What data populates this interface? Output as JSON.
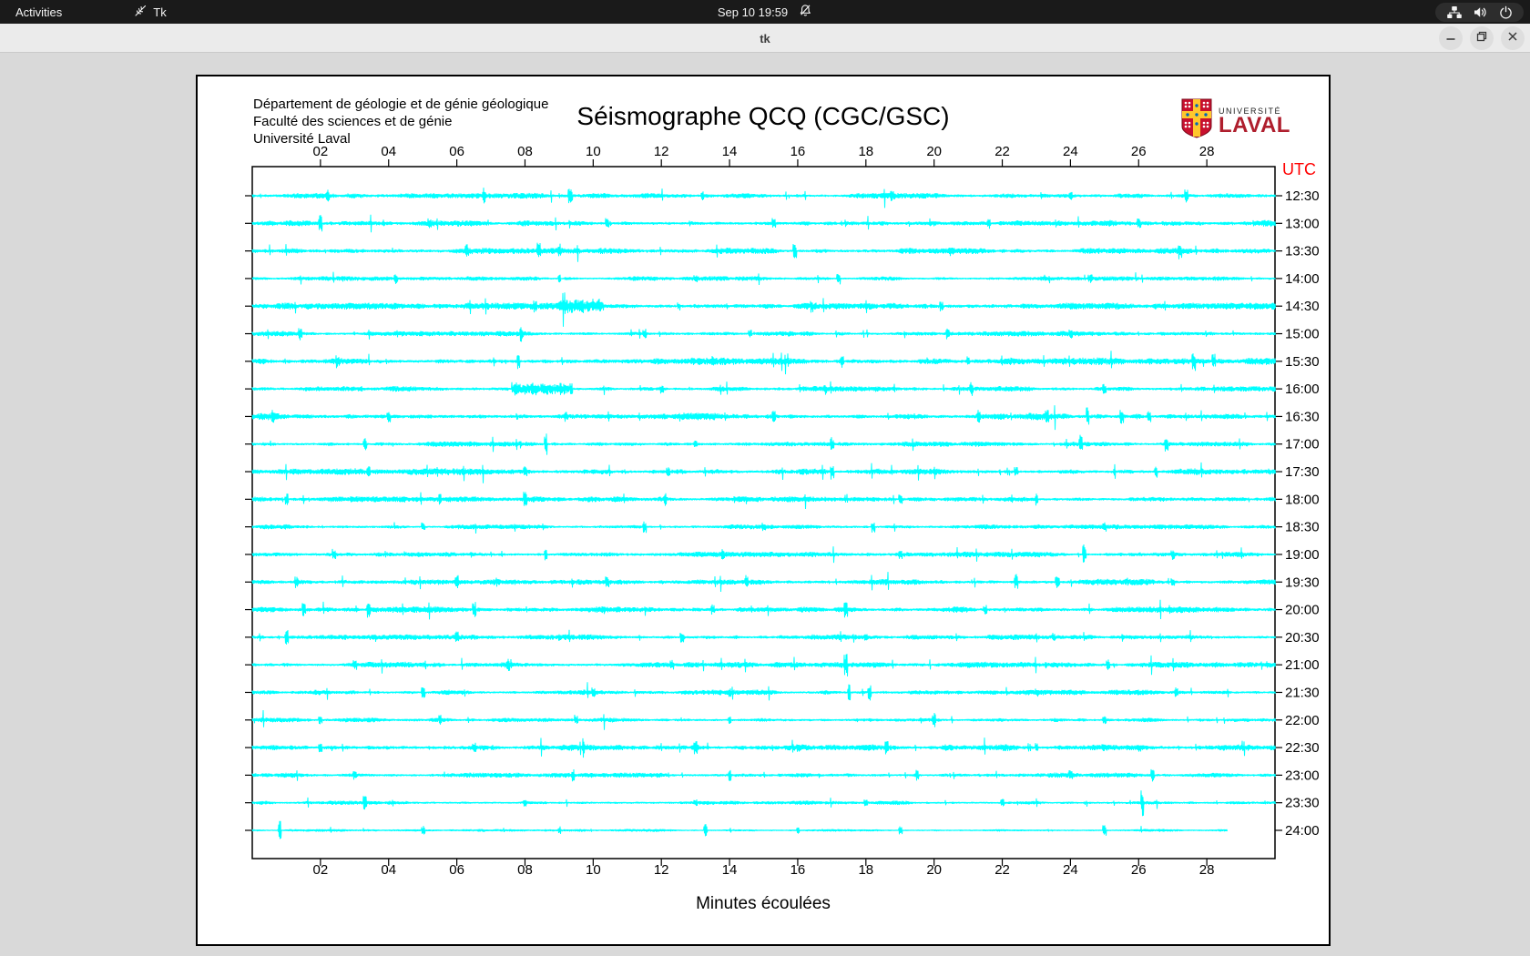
{
  "top_bar": {
    "activities": "Activities",
    "app_name": "Tk",
    "clock": "Sep 10 19:59",
    "icons": [
      "tk-feather-icon",
      "notifications-disabled-icon",
      "network-wired-icon",
      "volume-icon",
      "power-icon"
    ]
  },
  "title_bar": {
    "title": "tk",
    "icons": [
      "minimize-icon",
      "restore-icon",
      "close-icon"
    ]
  },
  "canvas": {
    "header_lines": [
      "Département de géologie et de génie géologique",
      "Faculté des sciences et de génie",
      "Université Laval"
    ],
    "title": "Séismographe QCQ (CGC/GSC)",
    "logo": {
      "line1": "UNIVERSITÉ",
      "line2": "LAVAL"
    },
    "x_axis_label": "Minutes écoulées",
    "utc_label": "UTC",
    "colors": {
      "trace": "#00ffff",
      "utc": "#ff0000",
      "axis": "#000000",
      "laval_red": "#af1e2d"
    },
    "plot": {
      "type": "heliplot-seismogram",
      "x_range_minutes": [
        0,
        30
      ],
      "x_ticks": [
        "02",
        "04",
        "06",
        "08",
        "10",
        "12",
        "14",
        "16",
        "18",
        "20",
        "22",
        "24",
        "26",
        "28"
      ],
      "rows": [
        {
          "label": "12:30",
          "end": 30,
          "base": 2.0,
          "seed": 101,
          "spikes": [
            [
              2.2,
              9
            ],
            [
              6.8,
              8
            ],
            [
              9.3,
              10
            ],
            [
              13.2,
              8
            ],
            [
              18.8,
              7
            ],
            [
              24.0,
              7
            ],
            [
              27.4,
              9
            ]
          ],
          "bursts": []
        },
        {
          "label": "13:00",
          "end": 30,
          "base": 2.4,
          "seed": 202,
          "spikes": [
            [
              2.0,
              12
            ],
            [
              5.2,
              7
            ],
            [
              10.4,
              8
            ],
            [
              15.3,
              7
            ],
            [
              21.6,
              7
            ],
            [
              26.0,
              6
            ]
          ],
          "bursts": []
        },
        {
          "label": "13:30",
          "end": 30,
          "base": 2.2,
          "seed": 303,
          "spikes": [
            [
              6.3,
              9
            ],
            [
              8.4,
              12
            ],
            [
              9.0,
              9
            ],
            [
              15.9,
              9
            ],
            [
              20.5,
              7
            ],
            [
              27.2,
              10
            ]
          ],
          "bursts": []
        },
        {
          "label": "14:00",
          "end": 30,
          "base": 1.6,
          "seed": 404,
          "spikes": [
            [
              4.2,
              7
            ],
            [
              9.0,
              6
            ],
            [
              13.0,
              5
            ],
            [
              17.2,
              8
            ],
            [
              24.6,
              5
            ]
          ],
          "bursts": []
        },
        {
          "label": "14:30",
          "end": 30,
          "base": 2.4,
          "seed": 505,
          "spikes": [
            [
              8.3,
              8
            ],
            [
              12.5,
              6
            ],
            [
              16.4,
              8
            ],
            [
              20.2,
              7
            ]
          ],
          "bursts": [
            [
              9.0,
              10.3,
              9
            ]
          ]
        },
        {
          "label": "15:00",
          "end": 30,
          "base": 1.9,
          "seed": 606,
          "spikes": [
            [
              1.4,
              8
            ],
            [
              7.9,
              9
            ],
            [
              11.5,
              7
            ],
            [
              14.6,
              6
            ],
            [
              20.4,
              8
            ],
            [
              24.0,
              6
            ]
          ],
          "bursts": []
        },
        {
          "label": "15:30",
          "end": 30,
          "base": 2.6,
          "seed": 707,
          "spikes": [
            [
              2.5,
              8
            ],
            [
              7.8,
              12
            ],
            [
              13.5,
              7
            ],
            [
              17.3,
              8
            ],
            [
              21.0,
              7
            ],
            [
              27.6,
              12
            ],
            [
              28.2,
              9
            ]
          ],
          "bursts": []
        },
        {
          "label": "16:00",
          "end": 30,
          "base": 2.0,
          "seed": 808,
          "spikes": [
            [
              12.0,
              6
            ],
            [
              16.8,
              7
            ],
            [
              21.1,
              9
            ],
            [
              25.0,
              6
            ]
          ],
          "bursts": [
            [
              7.6,
              9.4,
              8
            ]
          ]
        },
        {
          "label": "16:30",
          "end": 30,
          "base": 2.6,
          "seed": 909,
          "spikes": [
            [
              0.6,
              9
            ],
            [
              4.0,
              8
            ],
            [
              9.2,
              7
            ],
            [
              15.3,
              9
            ],
            [
              21.3,
              8
            ],
            [
              23.3,
              10
            ],
            [
              24.5,
              12
            ],
            [
              25.5,
              10
            ],
            [
              26.3,
              9
            ]
          ],
          "bursts": []
        },
        {
          "label": "17:00",
          "end": 30,
          "base": 1.9,
          "seed": 1010,
          "spikes": [
            [
              3.3,
              7
            ],
            [
              8.6,
              13
            ],
            [
              13.0,
              6
            ],
            [
              17.0,
              8
            ],
            [
              24.3,
              12
            ],
            [
              26.8,
              9
            ]
          ],
          "bursts": []
        },
        {
          "label": "17:30",
          "end": 30,
          "base": 2.4,
          "seed": 1111,
          "spikes": [
            [
              3.4,
              9
            ],
            [
              8.0,
              7
            ],
            [
              12.2,
              6
            ],
            [
              17.0,
              9
            ],
            [
              22.4,
              7
            ],
            [
              26.5,
              7
            ]
          ],
          "bursts": []
        },
        {
          "label": "18:00",
          "end": 30,
          "base": 2.1,
          "seed": 1212,
          "spikes": [
            [
              1.0,
              7
            ],
            [
              5.5,
              8
            ],
            [
              8.0,
              10
            ],
            [
              12.1,
              8
            ],
            [
              19.0,
              6
            ],
            [
              23.0,
              7
            ]
          ],
          "bursts": []
        },
        {
          "label": "18:30",
          "end": 30,
          "base": 1.7,
          "seed": 1313,
          "spikes": [
            [
              5.0,
              5
            ],
            [
              11.5,
              8
            ],
            [
              15.0,
              6
            ],
            [
              18.2,
              7
            ],
            [
              25.0,
              6
            ]
          ],
          "bursts": []
        },
        {
          "label": "19:00",
          "end": 30,
          "base": 2.0,
          "seed": 1414,
          "spikes": [
            [
              2.4,
              7
            ],
            [
              8.6,
              8
            ],
            [
              13.8,
              6
            ],
            [
              19.0,
              7
            ],
            [
              24.4,
              13
            ],
            [
              27.0,
              7
            ]
          ],
          "bursts": []
        },
        {
          "label": "19:30",
          "end": 30,
          "base": 2.2,
          "seed": 1515,
          "spikes": [
            [
              1.3,
              7
            ],
            [
              6.0,
              9
            ],
            [
              10.4,
              7
            ],
            [
              14.5,
              9
            ],
            [
              22.4,
              10
            ],
            [
              23.6,
              9
            ],
            [
              27.0,
              6
            ]
          ],
          "bursts": []
        },
        {
          "label": "20:00",
          "end": 30,
          "base": 2.3,
          "seed": 1616,
          "spikes": [
            [
              1.5,
              9
            ],
            [
              3.4,
              10
            ],
            [
              6.5,
              9
            ],
            [
              10.3,
              6
            ],
            [
              13.5,
              7
            ],
            [
              17.4,
              9
            ],
            [
              21.5,
              6
            ]
          ],
          "bursts": []
        },
        {
          "label": "20:30",
          "end": 30,
          "base": 2.0,
          "seed": 1717,
          "spikes": [
            [
              1.0,
              9
            ],
            [
              6.0,
              10
            ],
            [
              9.0,
              6
            ],
            [
              12.6,
              8
            ],
            [
              18.0,
              6
            ],
            [
              23.5,
              5
            ]
          ],
          "bursts": []
        },
        {
          "label": "21:00",
          "end": 30,
          "base": 2.1,
          "seed": 1818,
          "spikes": [
            [
              3.0,
              6
            ],
            [
              7.5,
              7
            ],
            [
              12.3,
              6
            ],
            [
              17.4,
              13
            ],
            [
              21.0,
              6
            ],
            [
              25.1,
              8
            ]
          ],
          "bursts": []
        },
        {
          "label": "21:30",
          "end": 30,
          "base": 1.9,
          "seed": 1919,
          "spikes": [
            [
              5.0,
              8
            ],
            [
              10.0,
              7
            ],
            [
              14.0,
              6
            ],
            [
              17.5,
              11
            ],
            [
              18.1,
              9
            ],
            [
              23.0,
              6
            ],
            [
              27.1,
              7
            ]
          ],
          "bursts": []
        },
        {
          "label": "22:00",
          "end": 30,
          "base": 1.7,
          "seed": 2020,
          "spikes": [
            [
              2.0,
              5
            ],
            [
              5.5,
              8
            ],
            [
              9.5,
              6
            ],
            [
              14.0,
              5
            ],
            [
              20.0,
              9
            ],
            [
              25.0,
              5
            ]
          ],
          "bursts": []
        },
        {
          "label": "22:30",
          "end": 30,
          "base": 2.4,
          "seed": 2121,
          "spikes": [
            [
              2.0,
              7
            ],
            [
              6.5,
              6
            ],
            [
              13.0,
              9
            ],
            [
              16.0,
              6
            ],
            [
              18.6,
              9
            ],
            [
              23.0,
              6
            ],
            [
              26.0,
              6
            ]
          ],
          "bursts": []
        },
        {
          "label": "23:00",
          "end": 30,
          "base": 1.8,
          "seed": 2222,
          "spikes": [
            [
              3.0,
              6
            ],
            [
              9.4,
              9
            ],
            [
              14.0,
              8
            ],
            [
              19.5,
              6
            ],
            [
              24.0,
              8
            ],
            [
              26.4,
              8
            ]
          ],
          "bursts": []
        },
        {
          "label": "23:30",
          "end": 30,
          "base": 1.5,
          "seed": 2323,
          "spikes": [
            [
              3.3,
              8
            ],
            [
              8.0,
              5
            ],
            [
              13.0,
              5
            ],
            [
              18.0,
              5
            ],
            [
              22.0,
              5
            ],
            [
              26.1,
              16
            ]
          ],
          "bursts": []
        },
        {
          "label": "24:00",
          "end": 28.6,
          "base": 1.0,
          "seed": 2424,
          "spikes": [
            [
              0.8,
              12
            ],
            [
              5.0,
              5
            ],
            [
              9.0,
              5
            ],
            [
              13.3,
              7
            ],
            [
              16.0,
              5
            ],
            [
              19.0,
              7
            ],
            [
              25.0,
              8
            ]
          ],
          "bursts": []
        }
      ]
    }
  }
}
